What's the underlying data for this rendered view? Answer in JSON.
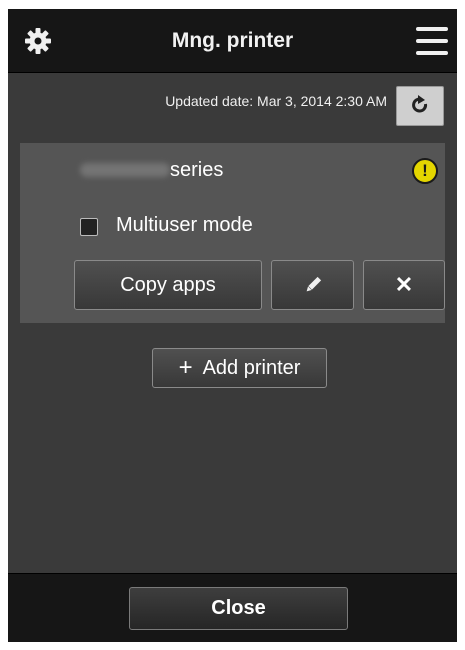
{
  "header": {
    "title": "Mng. printer",
    "settings_icon": "gear-icon",
    "menu_icon": "hamburger-menu-icon"
  },
  "status": {
    "updated_text": "Updated date: Mar 3, 2014 2:30 AM",
    "refresh_icon": "refresh-icon"
  },
  "printer": {
    "series_label": "series",
    "status_icon": "warning-icon",
    "status_symbol": "!",
    "multiuser_label": "Multiuser mode",
    "multiuser_checked": false
  },
  "actions": {
    "copy_apps_label": "Copy apps",
    "edit_icon": "pencil-icon",
    "delete_icon": "close-x-icon",
    "delete_symbol": "✕",
    "add_plus_symbol": "+",
    "add_printer_label": "Add printer"
  },
  "footer": {
    "close_label": "Close"
  },
  "colors": {
    "header_bg": "#161616",
    "content_bg": "#3a3a3a",
    "card_bg": "#555555",
    "warning": "#e4d600",
    "refresh_bg": "#cfcfcf"
  }
}
